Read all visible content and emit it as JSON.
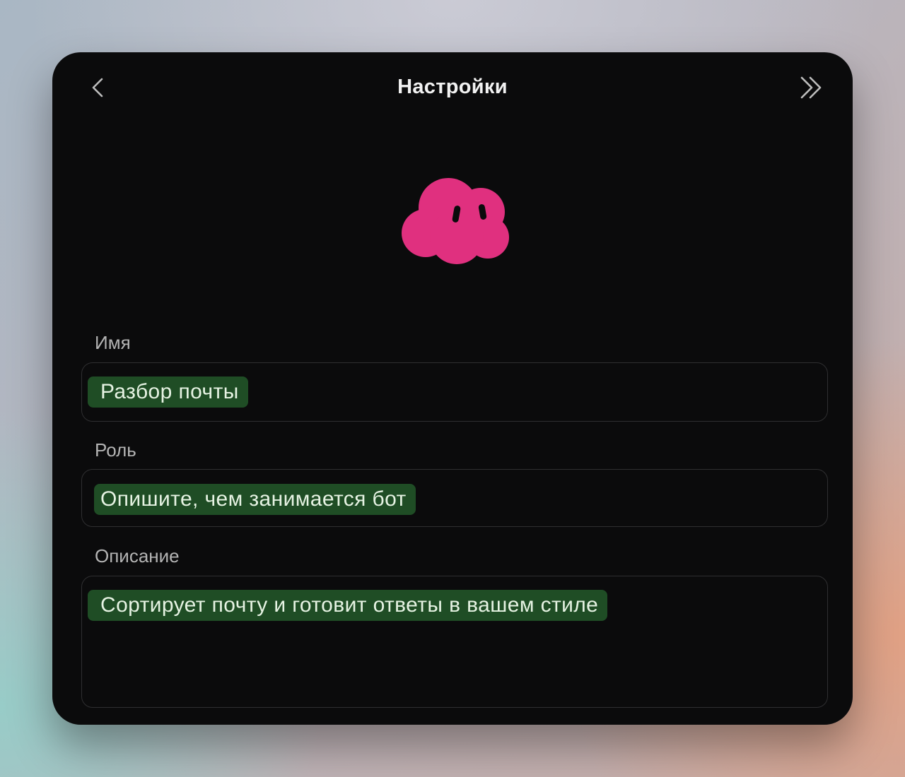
{
  "header": {
    "title": "Настройки",
    "back_icon": "chevron-left-icon",
    "collapse_icon": "double-chevron-right-icon"
  },
  "avatar": {
    "icon": "cloud-mascot-icon",
    "color": "#e0307f"
  },
  "fields": {
    "name": {
      "label": "Имя",
      "value": "Разбор почты"
    },
    "role": {
      "label": "Роль",
      "value": "Опишите, чем занимается бот"
    },
    "description": {
      "label": "Описание",
      "value": "Сортирует почту и готовит ответы в вашем стиле"
    }
  },
  "colors": {
    "panel_bg": "#0b0b0c",
    "chip_bg": "#1f4d25",
    "chip_text": "#e6f3e3"
  }
}
